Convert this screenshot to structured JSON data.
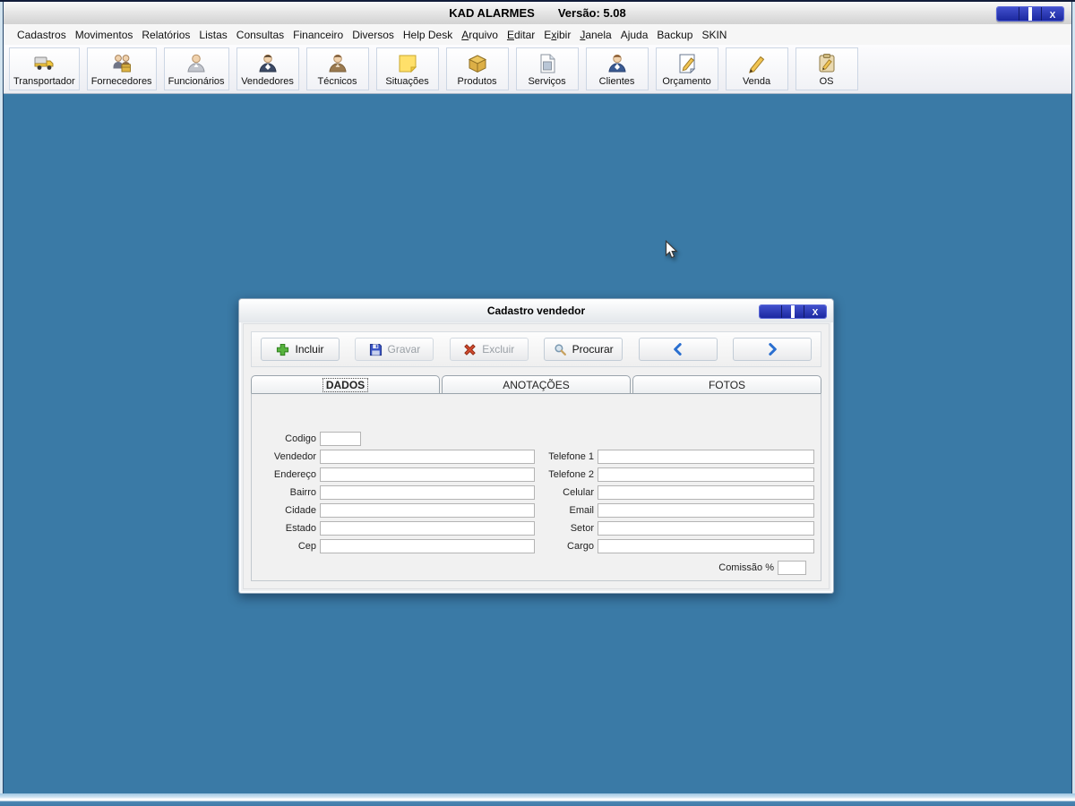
{
  "window": {
    "title": "KAD ALARMES",
    "version": "Versão: 5.08",
    "controls": [
      {
        "key": "minimize",
        "icon": "minimize-icon"
      },
      {
        "key": "maximize",
        "icon": "maximize-icon"
      },
      {
        "key": "close",
        "icon": "close-icon"
      }
    ]
  },
  "menubar": {
    "items": [
      {
        "label": "Cadastros"
      },
      {
        "label": "Movimentos"
      },
      {
        "label": "Relatórios"
      },
      {
        "label": "Listas"
      },
      {
        "label": "Consultas"
      },
      {
        "label": "Financeiro"
      },
      {
        "label": "Diversos"
      },
      {
        "label": "Help Desk"
      },
      {
        "label": "Arquivo",
        "underline": 0
      },
      {
        "label": "Editar",
        "underline": 0
      },
      {
        "label": "Exibir",
        "underline": 1
      },
      {
        "label": "Janela",
        "underline": 0
      },
      {
        "label": "Ajuda"
      },
      {
        "label": "Backup"
      },
      {
        "label": "SKIN"
      }
    ]
  },
  "toolbar": {
    "buttons": [
      {
        "label": "Transportador",
        "icon": "truck-icon"
      },
      {
        "label": "Fornecedores",
        "icon": "suppliers-icon"
      },
      {
        "label": "Funcionários",
        "icon": "employee-icon"
      },
      {
        "label": "Vendedores",
        "icon": "salesperson-icon"
      },
      {
        "label": "Técnicos",
        "icon": "technician-icon"
      },
      {
        "label": "Situações",
        "icon": "sticky-note-icon"
      },
      {
        "label": "Produtos",
        "icon": "box-icon"
      },
      {
        "label": "Serviços",
        "icon": "document-icon"
      },
      {
        "label": "Clientes",
        "icon": "client-icon"
      },
      {
        "label": "Orçamento",
        "icon": "budget-icon"
      },
      {
        "label": "Venda",
        "icon": "pencil-icon"
      },
      {
        "label": "OS",
        "icon": "clipboard-icon"
      }
    ]
  },
  "dialog": {
    "title": "Cadastro vendedor",
    "controls": [
      {
        "key": "minimize",
        "icon": "minimize-icon"
      },
      {
        "key": "maximize",
        "icon": "maximize-icon"
      },
      {
        "key": "close",
        "icon": "close-icon"
      }
    ],
    "actions": [
      {
        "key": "incluir",
        "label": "Incluir",
        "icon": "plus-icon",
        "enabled": true
      },
      {
        "key": "gravar",
        "label": "Gravar",
        "icon": "save-icon",
        "enabled": false
      },
      {
        "key": "excluir",
        "label": "Excluir",
        "icon": "delete-icon",
        "enabled": false
      },
      {
        "key": "procurar",
        "label": "Procurar",
        "icon": "search-icon",
        "enabled": true
      },
      {
        "key": "previous",
        "label": "",
        "icon": "chevron-left-icon",
        "enabled": true
      },
      {
        "key": "next",
        "label": "",
        "icon": "chevron-right-icon",
        "enabled": true
      }
    ],
    "tabs": [
      {
        "label": "DADOS",
        "active": true
      },
      {
        "label": "ANOTAÇÕES",
        "active": false
      },
      {
        "label": "FOTOS",
        "active": false
      }
    ],
    "form": {
      "left_fields": [
        {
          "key": "codigo",
          "label": "Codigo",
          "value": "",
          "small": true
        },
        {
          "key": "vendedor",
          "label": "Vendedor",
          "value": ""
        },
        {
          "key": "endereco",
          "label": "Endereço",
          "value": ""
        },
        {
          "key": "bairro",
          "label": "Bairro",
          "value": ""
        },
        {
          "key": "cidade",
          "label": "Cidade",
          "value": ""
        },
        {
          "key": "estado",
          "label": "Estado",
          "value": ""
        },
        {
          "key": "cep",
          "label": "Cep",
          "value": ""
        }
      ],
      "right_fields": [
        {
          "key": "telefone1",
          "label": "Telefone 1",
          "value": ""
        },
        {
          "key": "telefone2",
          "label": "Telefone 2",
          "value": ""
        },
        {
          "key": "celular",
          "label": "Celular",
          "value": ""
        },
        {
          "key": "email",
          "label": "Email",
          "value": ""
        },
        {
          "key": "setor",
          "label": "Setor",
          "value": ""
        },
        {
          "key": "cargo",
          "label": "Cargo",
          "value": ""
        }
      ],
      "comissao": {
        "key": "comissao",
        "label": "Comissão %",
        "value": ""
      }
    }
  },
  "colors": {
    "desktop": "#3A7AA6",
    "control_button": "#2230AC",
    "accent_blue": "#2A6FD0",
    "disabled_text": "#9AA0A6"
  }
}
